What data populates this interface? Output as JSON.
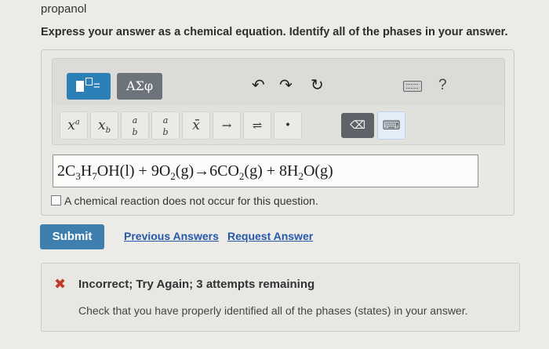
{
  "question": {
    "topline": "propanol",
    "instruction": "Express your answer as a chemical equation. Identify all of the phases in your answer."
  },
  "toolbar": {
    "symbols_label": "ΑΣφ",
    "undo_icon": "↶",
    "redo_icon": "↷",
    "reset_icon": "↻",
    "help_label": "?",
    "buttons": [
      {
        "name": "superscript-button",
        "label": "x",
        "sup": "a"
      },
      {
        "name": "subscript-button",
        "label": "x",
        "sub": "b"
      },
      {
        "name": "fraction-button",
        "num": "a",
        "den": "b"
      },
      {
        "name": "fraction-small-button",
        "num": "a",
        "den": "b"
      },
      {
        "name": "overline-button",
        "label": "x̄"
      },
      {
        "name": "right-arrow-button",
        "label": "→"
      },
      {
        "name": "equilibrium-button",
        "label": "⇌"
      },
      {
        "name": "dot-button",
        "label": "•"
      },
      {
        "name": "delete-button",
        "label": "⌫"
      },
      {
        "name": "keyboard-button",
        "label": "⌨"
      }
    ]
  },
  "answer": {
    "equation_text": "2C3H7OH(l) + 9O2(g)→6CO2(g) + 8H2O(g)"
  },
  "no_reaction": {
    "label": "A chemical reaction does not occur for this question."
  },
  "actions": {
    "submit": "Submit",
    "previous_answers": "Previous Answers",
    "request_answer": "Request Answer"
  },
  "feedback": {
    "title": "Incorrect; Try Again; 3 attempts remaining",
    "message": "Check that you have properly identified all of the phases (states) in your answer."
  },
  "colors": {
    "accent": "#2d7fb8",
    "error": "#c0392b",
    "link": "#2459a8"
  }
}
